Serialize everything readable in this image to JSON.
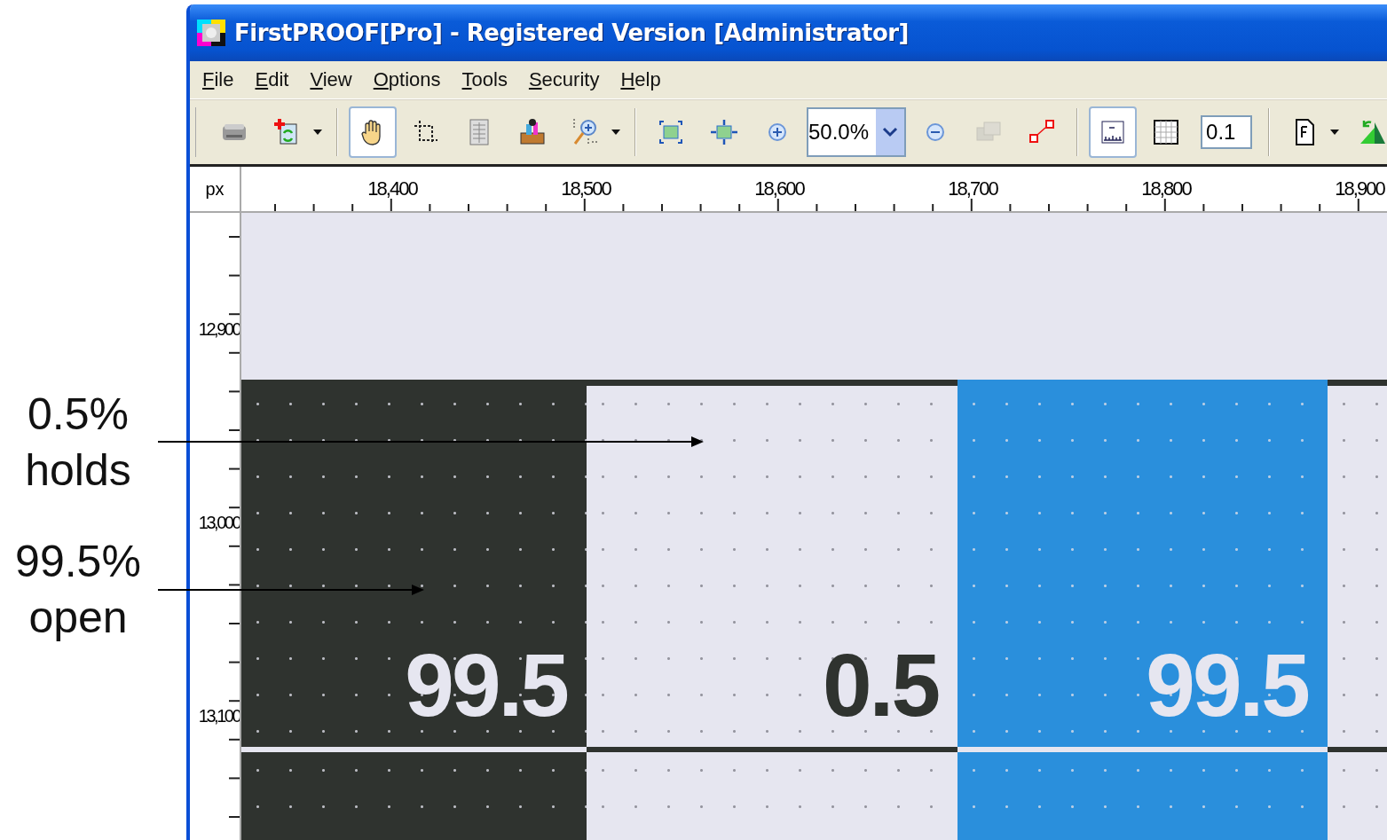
{
  "window": {
    "title": "FirstPROOF[Pro] - Registered Version [Administrator]"
  },
  "menu": [
    {
      "label": "File"
    },
    {
      "label": "Edit"
    },
    {
      "label": "View"
    },
    {
      "label": "Options"
    },
    {
      "label": "Tools"
    },
    {
      "label": "Security"
    },
    {
      "label": "Help"
    }
  ],
  "toolbar": [
    {
      "kind": "scanner",
      "selected": false,
      "dropdown": false
    },
    {
      "kind": "add-file",
      "selected": false,
      "dropdown": true
    },
    {
      "kind": "sep"
    },
    {
      "kind": "hand",
      "selected": true,
      "dropdown": false
    },
    {
      "kind": "crop",
      "selected": false,
      "dropdown": false
    },
    {
      "kind": "document",
      "selected": false,
      "dropdown": false
    },
    {
      "kind": "toolbox",
      "selected": false,
      "dropdown": false
    },
    {
      "kind": "zoom-area",
      "selected": false,
      "dropdown": true
    },
    {
      "kind": "sep"
    },
    {
      "kind": "fit-page",
      "selected": false,
      "dropdown": false
    },
    {
      "kind": "fit-width",
      "selected": false,
      "dropdown": false
    },
    {
      "kind": "zoom-in",
      "selected": false,
      "dropdown": false
    },
    {
      "kind": "zoom-field",
      "value": "50.0%"
    },
    {
      "kind": "zoom-out",
      "selected": false,
      "dropdown": false
    },
    {
      "kind": "compare",
      "selected": false,
      "dropdown": false,
      "disabled": true
    },
    {
      "kind": "resize",
      "selected": false,
      "dropdown": false
    },
    {
      "kind": "sep"
    },
    {
      "kind": "ruler",
      "selected": true,
      "dropdown": false
    },
    {
      "kind": "grid",
      "selected": false,
      "dropdown": false
    },
    {
      "kind": "grid-field",
      "value": "0.1"
    },
    {
      "kind": "sep"
    },
    {
      "kind": "page-f",
      "selected": false,
      "dropdown": true
    },
    {
      "kind": "triangle-arrow",
      "selected": false
    }
  ],
  "ruler": {
    "unit": "px",
    "x_labels": [
      "18,400",
      "18,500",
      "18,600",
      "18,700",
      "18,800",
      "18,900"
    ],
    "y_labels": [
      "12,900",
      "13,000",
      "13,100"
    ]
  },
  "patches": [
    {
      "value": "99.5",
      "color": "#2f332f"
    },
    {
      "value": "0.5",
      "color": "#e6e6f0"
    },
    {
      "value": "99.5",
      "color": "#2a8fdc"
    },
    {
      "color": "#e6e6f0"
    }
  ],
  "annotations": [
    {
      "lines": [
        "0.5%",
        "holds"
      ]
    },
    {
      "lines": [
        "99.5%",
        "open"
      ]
    }
  ]
}
